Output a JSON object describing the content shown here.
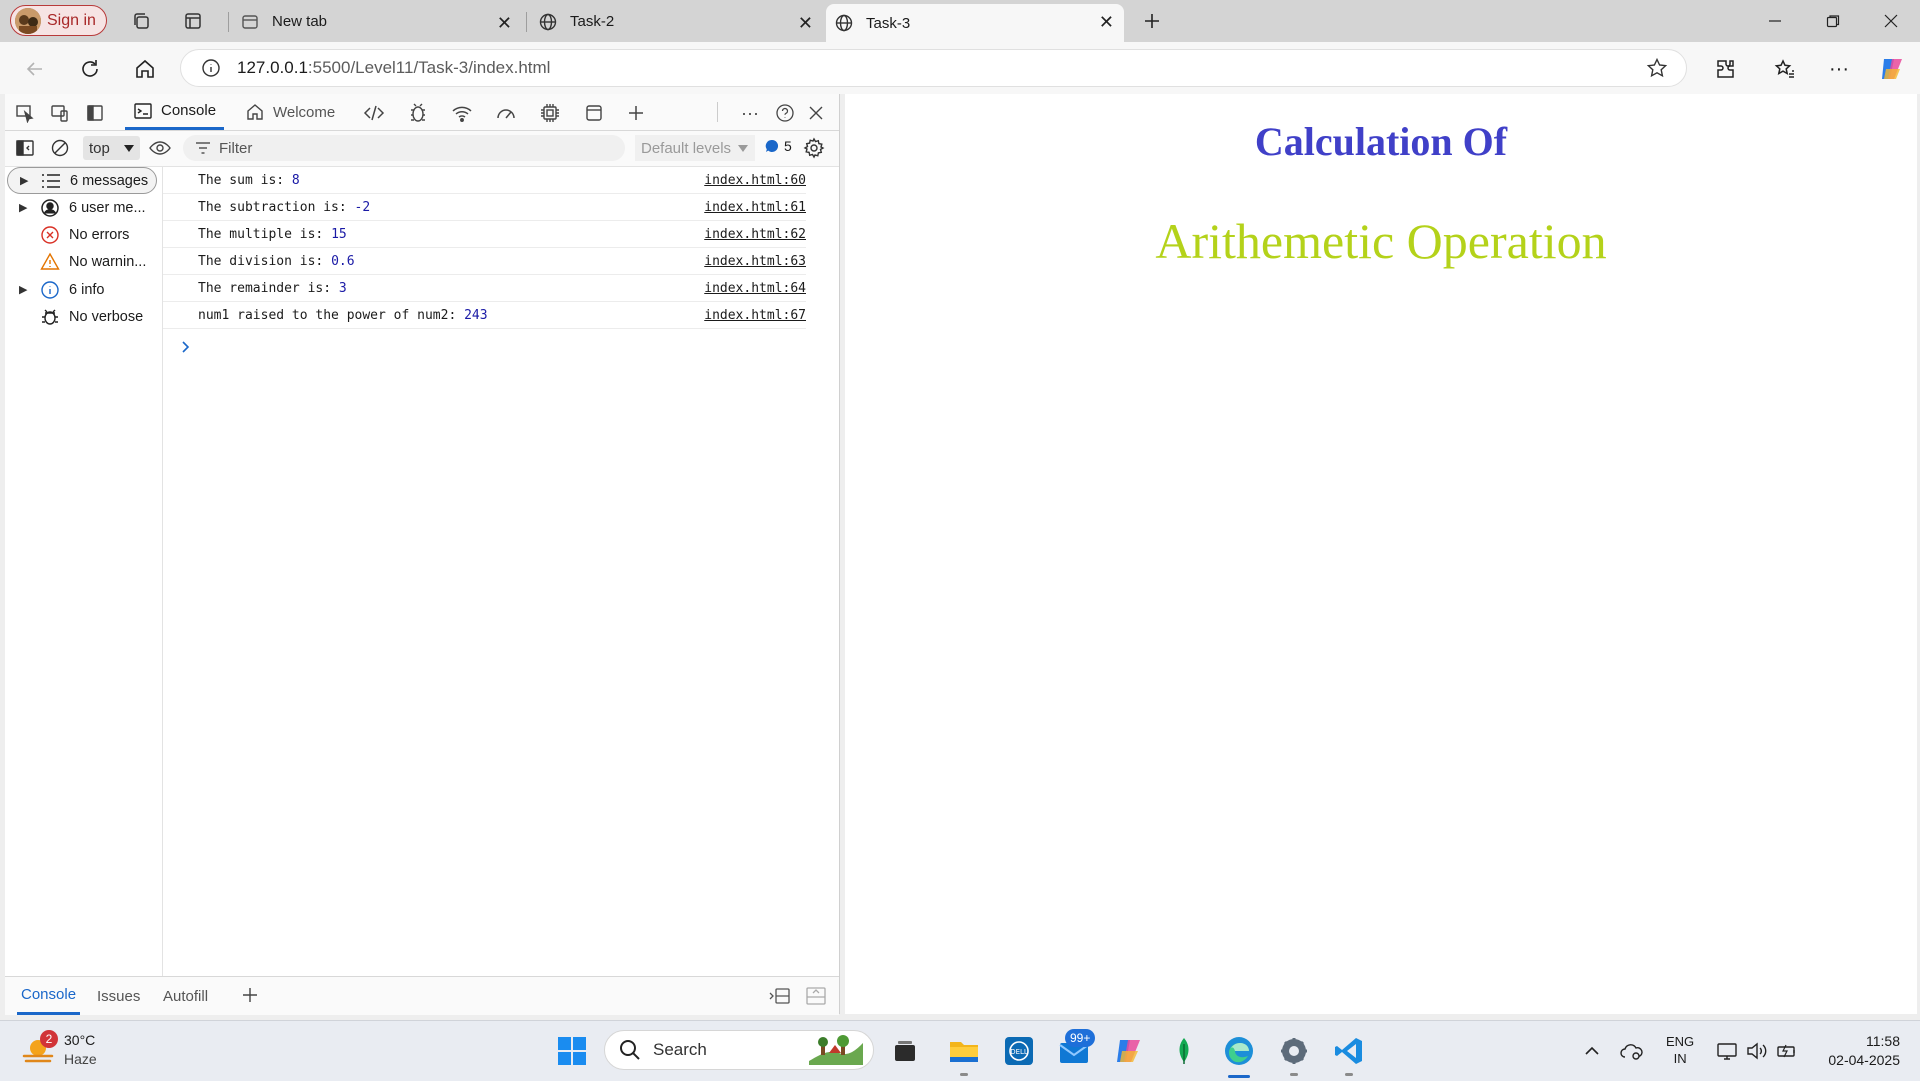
{
  "browser": {
    "signin_label": "Sign in",
    "tabs": [
      {
        "title": "New tab"
      },
      {
        "title": "Task-2"
      },
      {
        "title": "Task-3"
      }
    ],
    "url_host": "127.0.0.1",
    "url_rest": ":5500/Level11/Task-3/index.html"
  },
  "devtools": {
    "tabs": [
      {
        "label": "Console"
      },
      {
        "label": "Welcome"
      }
    ],
    "context_select": "top",
    "filter_placeholder": "Filter",
    "levels_label": "Default levels",
    "issues_count": "5",
    "sidebar": [
      {
        "label": "6 messages"
      },
      {
        "label": "6 user me..."
      },
      {
        "label": "No errors"
      },
      {
        "label": "No warnin..."
      },
      {
        "label": "6 info"
      },
      {
        "label": "No verbose"
      }
    ],
    "messages": [
      {
        "text": "The sum is: ",
        "value": "8",
        "source": "index.html:60"
      },
      {
        "text": "The subtraction is: ",
        "value": "-2",
        "source": "index.html:61"
      },
      {
        "text": "The multiple is: ",
        "value": "15",
        "source": "index.html:62"
      },
      {
        "text": "The division is: ",
        "value": "0.6",
        "source": "index.html:63"
      },
      {
        "text": "The remainder is: ",
        "value": "3",
        "source": "index.html:64"
      },
      {
        "text": "num1 raised to the power of num2: ",
        "value": "243",
        "source": "index.html:67"
      }
    ],
    "drawer_tabs": [
      {
        "label": "Console"
      },
      {
        "label": "Issues"
      },
      {
        "label": "Autofill"
      }
    ]
  },
  "page": {
    "heading": "Calculation Of",
    "subheading": "Arithemetic Operation"
  },
  "taskbar": {
    "weather_temp": "30°C",
    "weather_desc": "Haze",
    "weather_badge": "2",
    "search_label": "Search",
    "mail_badge": "99+",
    "lang_1": "ENG",
    "lang_2": "IN",
    "time": "11:58",
    "date": "02-04-2025"
  },
  "colors": {
    "heading": "#4040c8",
    "subheading": "#b4d21a",
    "accent": "#1a67c9"
  }
}
